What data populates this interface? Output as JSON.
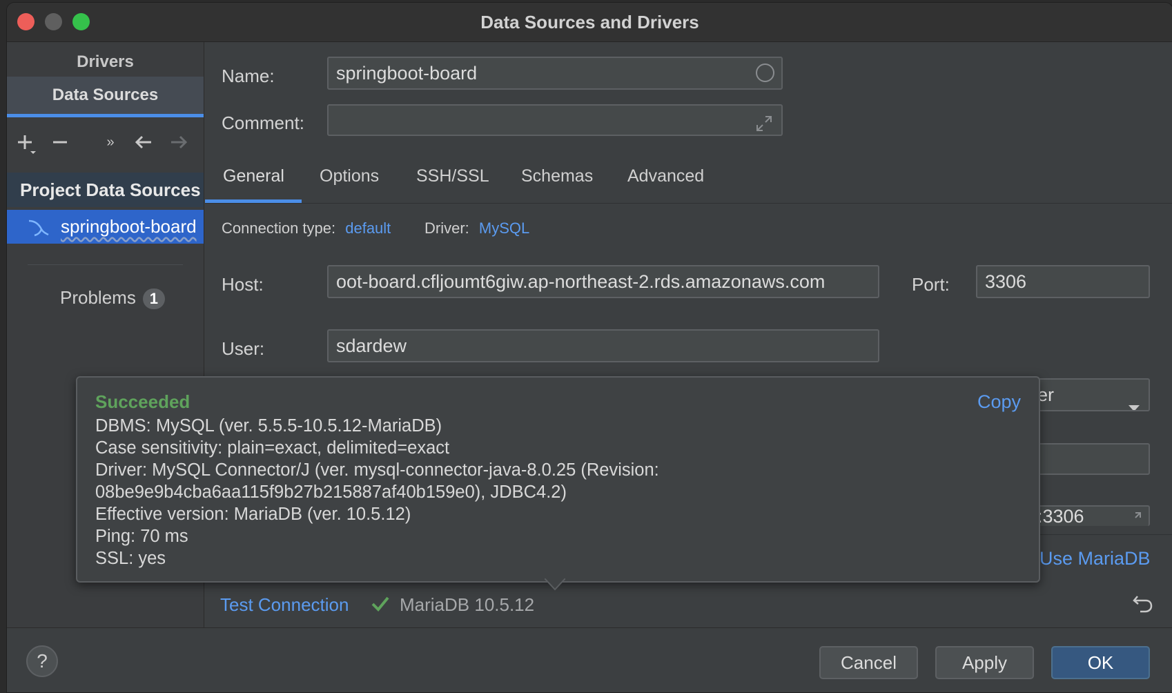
{
  "window": {
    "title": "Data Sources and Drivers"
  },
  "sidebar": {
    "tab_drivers": "Drivers",
    "tab_data_sources": "Data Sources",
    "group_header": "Project Data Sources",
    "item": "springboot-board",
    "problems_label": "Problems",
    "problems_count": "1"
  },
  "form": {
    "name_label": "Name:",
    "name_value": "springboot-board",
    "comment_label": "Comment:",
    "comment_value": "",
    "tabs": [
      "General",
      "Options",
      "SSH/SSL",
      "Schemas",
      "Advanced"
    ],
    "connection_type_label": "Connection type:",
    "connection_type_value": "default",
    "driver_label": "Driver:",
    "driver_value": "MySQL",
    "host_label": "Host:",
    "host_value": "oot-board.cfljoumt6giw.ap-northeast-2.rds.amazonaws.com",
    "port_label": "Port:",
    "port_value": "3306",
    "user_label": "User:",
    "user_value": "sdardew",
    "auth_partial": "er",
    "url_partial": ":3306",
    "use_mariadb": "Use MariaDB"
  },
  "popup": {
    "status": "Succeeded",
    "copy_label": "Copy",
    "lines": [
      "DBMS: MySQL (ver. 5.5.5-10.5.12-MariaDB)",
      "Case sensitivity: plain=exact, delimited=exact",
      "Driver: MySQL Connector/J (ver. mysql-connector-java-8.0.25 (Revision:",
      "08be9e9b4cba6aa115f9b27b215887af40b159e0), JDBC4.2)",
      "Effective version: MariaDB (ver. 10.5.12)",
      "Ping: 70 ms",
      "SSL: yes"
    ]
  },
  "footer": {
    "test_connection": "Test Connection",
    "test_result": "MariaDB 10.5.12",
    "help": "?",
    "cancel": "Cancel",
    "apply": "Apply",
    "ok": "OK"
  },
  "colors": {
    "accent": "#4b8ee8",
    "link": "#5b9bf0",
    "success": "#5fa35c",
    "selection": "#2e65ca"
  }
}
